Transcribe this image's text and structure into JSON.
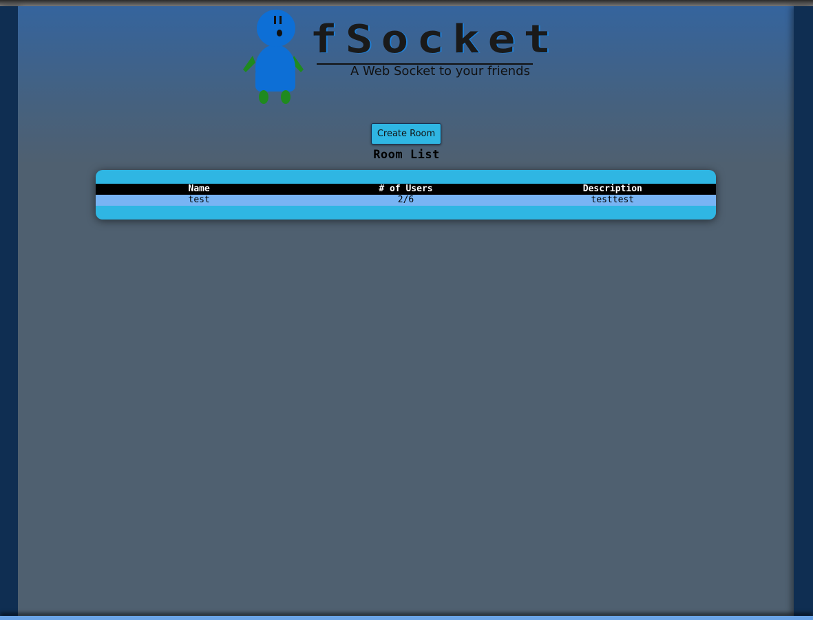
{
  "header": {
    "logo_text": "fSocket",
    "tagline": "A Web Socket to your friends"
  },
  "actions": {
    "create_room_label": "Create Room"
  },
  "room_list": {
    "title": "Room List",
    "columns": [
      "Name",
      "# of Users",
      "Description"
    ],
    "rows": [
      [
        "test",
        "2/6",
        "testtest"
      ]
    ]
  },
  "colors": {
    "accent": "#2fb6e3",
    "row_highlight": "#78b4f4",
    "header_bg": "#000000",
    "side_panel": "#0f2e52",
    "mascot_body": "#0d6fd6",
    "mascot_limbs": "#1f8a1f"
  },
  "icons": {
    "mascot": "stick-figure-mascot-icon"
  }
}
